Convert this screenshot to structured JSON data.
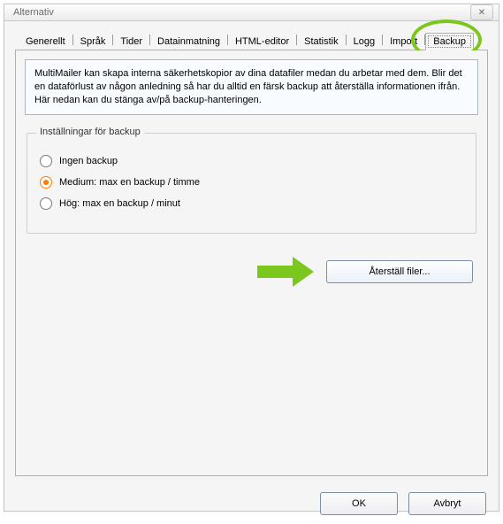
{
  "window": {
    "title": "Alternativ",
    "close_glyph": "✕"
  },
  "tabs": [
    {
      "label": "Generellt"
    },
    {
      "label": "Språk"
    },
    {
      "label": "Tider"
    },
    {
      "label": "Datainmatning"
    },
    {
      "label": "HTML-editor"
    },
    {
      "label": "Statistik"
    },
    {
      "label": "Logg"
    },
    {
      "label": "Import"
    },
    {
      "label": "Backup",
      "active": true
    }
  ],
  "infobox_text": "MultiMailer kan skapa interna säkerhetskopior av dina datafiler medan du arbetar med dem. Blir det en dataförlust av någon anledning så har du alltid en färsk backup att återställa informationen ifrån. Här nedan kan du stänga av/på backup-hanteringen.",
  "group": {
    "legend": "Inställningar för backup",
    "options": [
      {
        "id": "none",
        "label": "Ingen backup"
      },
      {
        "id": "medium",
        "label": "Medium: max en backup / timme",
        "selected": true
      },
      {
        "id": "high",
        "label": "Hög: max en backup / minut"
      }
    ]
  },
  "buttons": {
    "restore": "Återställ filer...",
    "ok": "OK",
    "cancel": "Avbryt"
  },
  "annotations": {
    "circle_target": "tab-backup",
    "arrow_target": "restore-button"
  }
}
